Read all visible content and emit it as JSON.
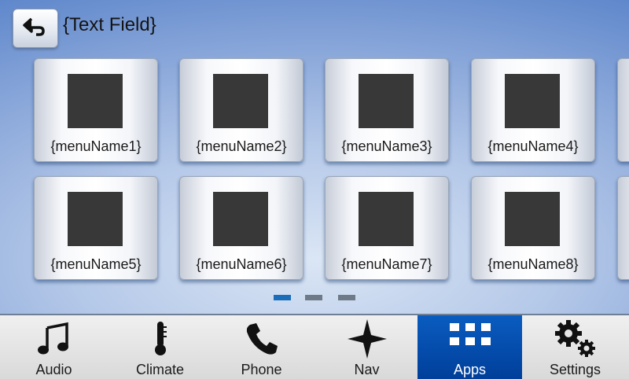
{
  "header": {
    "title": "{Text Field}",
    "back_icon": "back-arrow-icon"
  },
  "menu_items": [
    {
      "label": "{menuName1}"
    },
    {
      "label": "{menuName2}"
    },
    {
      "label": "{menuName3}"
    },
    {
      "label": "{menuName4}"
    },
    {
      "label": "{menuName5}"
    },
    {
      "label": "{menuName6}"
    },
    {
      "label": "{menuName7}"
    },
    {
      "label": "{menuName8}"
    }
  ],
  "pagination": {
    "pages": 3,
    "current": 1
  },
  "nav": {
    "items": [
      {
        "label": "Audio",
        "icon": "music-note-icon"
      },
      {
        "label": "Climate",
        "icon": "thermometer-icon"
      },
      {
        "label": "Phone",
        "icon": "phone-icon"
      },
      {
        "label": "Nav",
        "icon": "compass-star-icon"
      },
      {
        "label": "Apps",
        "icon": "apps-grid-icon",
        "active": true
      },
      {
        "label": "Settings",
        "icon": "gears-icon"
      }
    ],
    "active_color": "#0a5cc0"
  }
}
